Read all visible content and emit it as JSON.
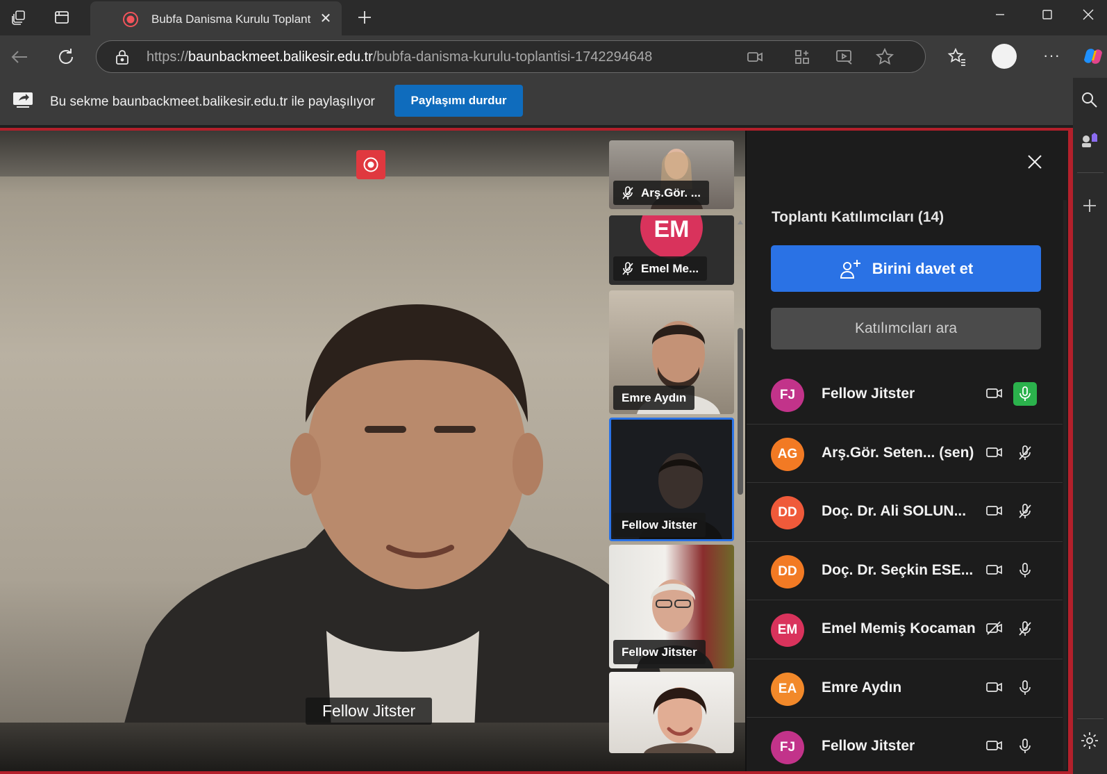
{
  "browser": {
    "tab_title": "Bubfa Danisma Kurulu Toplantisi",
    "url_scheme": "https://",
    "url_host": "baunbackmeet.balikesir.edu.tr",
    "url_path": "/bubfa-danisma-kurulu-toplantisi-1742294648"
  },
  "share_bar": {
    "text": "Bu sekme baunbackmeet.balikesir.edu.tr ile paylaşılıyor",
    "stop_button": "Paylaşımı durdur"
  },
  "main_video": {
    "speaker_name": "Fellow Jitster"
  },
  "thumbnails": [
    {
      "label": "Arş.Gör. ...",
      "muted": true
    },
    {
      "label": "Emel Me...",
      "muted": true,
      "initials": "EM"
    },
    {
      "label": "Emre Aydın",
      "muted": false
    },
    {
      "label": "Fellow Jitster",
      "muted": false,
      "active": true
    },
    {
      "label": "Fellow Jitster",
      "muted": false
    },
    {
      "label": "",
      "muted": false
    }
  ],
  "panel": {
    "title": "Toplantı Katılımcıları (14)",
    "invite_button": "Birini davet et",
    "search_placeholder": "Katılımcıları ara",
    "participants": [
      {
        "initials": "FJ",
        "name": "Fellow Jitster",
        "color": "#c2338a",
        "camera": "on",
        "mic": "speaking"
      },
      {
        "initials": "AG",
        "name": "Arş.Gör. Seten... (sen)",
        "color": "#f27a24",
        "camera": "on",
        "mic": "muted"
      },
      {
        "initials": "DD",
        "name": "Doç. Dr. Ali SOLUN...",
        "color": "#ef5a3a",
        "camera": "on",
        "mic": "muted"
      },
      {
        "initials": "DD",
        "name": "Doç. Dr. Seçkin ESE...",
        "color": "#f27a24",
        "camera": "on",
        "mic": "on"
      },
      {
        "initials": "EM",
        "name": "Emel Memiş Kocaman",
        "color": "#d9335c",
        "camera": "off",
        "mic": "muted"
      },
      {
        "initials": "EA",
        "name": "Emre Aydın",
        "color": "#f2892a",
        "camera": "on",
        "mic": "on"
      },
      {
        "initials": "FJ",
        "name": "Fellow Jitster",
        "color": "#c2338a",
        "camera": "on",
        "mic": "on"
      }
    ]
  },
  "colors": {
    "accent_blue": "#2a72e5",
    "share_button": "#0f6cbd",
    "recording_red": "#e0383f",
    "frame_red": "#b3202b",
    "speaking_green": "#2bb24c"
  }
}
